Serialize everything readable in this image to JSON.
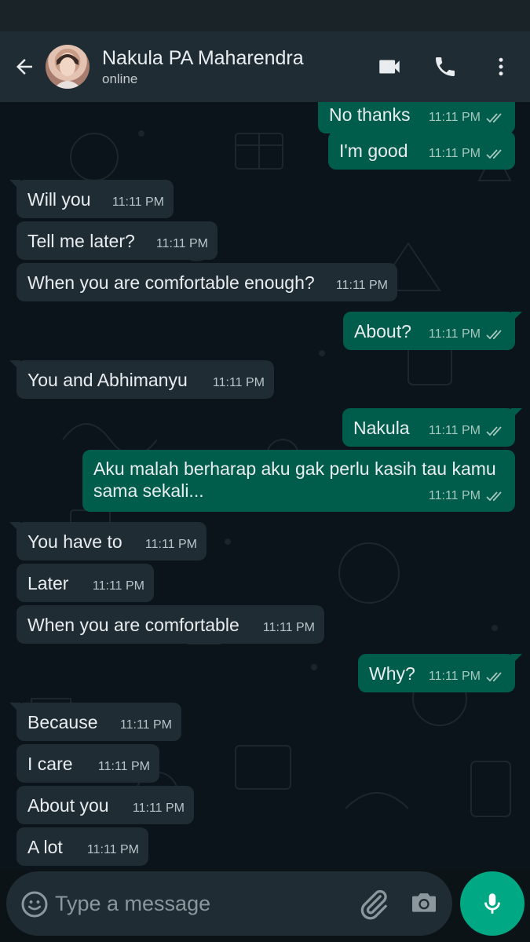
{
  "header": {
    "contact_name": "Nakula PA Maharendra",
    "status": "online"
  },
  "icons": {
    "back": "arrow-left",
    "video": "video-camera",
    "call": "phone",
    "menu": "more-vertical",
    "emoji": "emoji-smile",
    "attach": "paperclip",
    "camera": "camera",
    "mic": "microphone",
    "read_receipt": "double-check"
  },
  "colors": {
    "header_bg": "#1f2c33",
    "incoming_bubble": "#1f2c34",
    "outgoing_bubble": "#005c4b",
    "accent": "#00a884"
  },
  "messages": [
    {
      "direction": "out",
      "text": "No thanks",
      "time": "11:11 PM",
      "read": true
    },
    {
      "direction": "out",
      "text": "I'm good",
      "time": "11:11 PM",
      "read": true
    },
    {
      "direction": "in",
      "text": "Will you",
      "time": "11:11 PM"
    },
    {
      "direction": "in",
      "text": "Tell me later?",
      "time": "11:11 PM"
    },
    {
      "direction": "in",
      "text": "When you are comfortable enough?",
      "time": "11:11 PM"
    },
    {
      "direction": "out",
      "text": "About?",
      "time": "11:11 PM",
      "read": true
    },
    {
      "direction": "in",
      "text": "You and Abhimanyu",
      "time": "11:11 PM"
    },
    {
      "direction": "out",
      "text": "Nakula",
      "time": "11:11 PM",
      "read": true
    },
    {
      "direction": "out",
      "text": "Aku malah berharap aku gak perlu kasih tau kamu sama sekali...",
      "time": "11:11 PM",
      "read": true
    },
    {
      "direction": "in",
      "text": "You have to",
      "time": "11:11 PM"
    },
    {
      "direction": "in",
      "text": "Later",
      "time": "11:11 PM"
    },
    {
      "direction": "in",
      "text": "When you are comfortable",
      "time": "11:11 PM"
    },
    {
      "direction": "out",
      "text": "Why?",
      "time": "11:11 PM",
      "read": true
    },
    {
      "direction": "in",
      "text": "Because",
      "time": "11:11 PM"
    },
    {
      "direction": "in",
      "text": "I care",
      "time": "11:11 PM"
    },
    {
      "direction": "in",
      "text": "About you",
      "time": "11:11 PM"
    },
    {
      "direction": "in",
      "text": "A lot",
      "time": "11:11 PM"
    }
  ],
  "composer": {
    "placeholder": "Type a message"
  }
}
